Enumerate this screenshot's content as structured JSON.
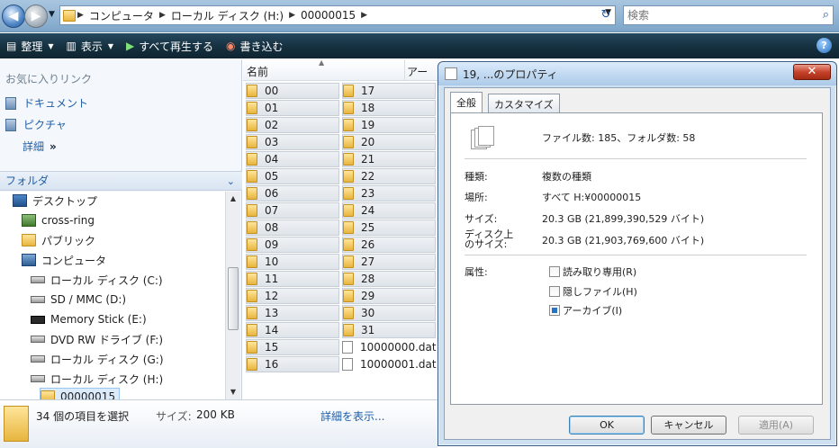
{
  "address": {
    "crumbs": [
      "コンピュータ",
      "ローカル ディスク (H:)",
      "00000015"
    ],
    "search_placeholder": "検索"
  },
  "toolbar": {
    "organize": "整理",
    "views": "表示",
    "play_all": "すべて再生する",
    "burn": "書き込む"
  },
  "favorites": {
    "title": "お気に入りリンク",
    "items": [
      "ドキュメント",
      "ピクチャ"
    ],
    "more": "詳細"
  },
  "folders": {
    "title": "フォルダ",
    "tree": [
      {
        "label": "デスクトップ",
        "icon": "desktop-icon"
      },
      {
        "label": "cross-ring",
        "icon": "network-icon"
      },
      {
        "label": "パブリック",
        "icon": "folder-icon"
      },
      {
        "label": "コンピュータ",
        "icon": "computer-icon"
      },
      {
        "label": "ローカル ディスク (C:)",
        "icon": "drive-icon"
      },
      {
        "label": "SD / MMC (D:)",
        "icon": "drive-icon"
      },
      {
        "label": "Memory Stick (E:)",
        "icon": "memory-stick-icon"
      },
      {
        "label": "DVD RW ドライブ (F:)",
        "icon": "dvd-drive-icon"
      },
      {
        "label": "ローカル ディスク (G:)",
        "icon": "drive-icon"
      },
      {
        "label": "ローカル ディスク (H:)",
        "icon": "drive-icon"
      },
      {
        "label": "00000015",
        "icon": "folder-icon"
      }
    ]
  },
  "filelist": {
    "col_name": "名前",
    "col_archive": "アー",
    "col1": [
      "00",
      "01",
      "02",
      "03",
      "04",
      "05",
      "06",
      "07",
      "08",
      "09",
      "10",
      "11",
      "12",
      "13",
      "14",
      "15",
      "16"
    ],
    "col2": [
      "17",
      "18",
      "19",
      "20",
      "21",
      "22",
      "23",
      "24",
      "25",
      "26",
      "27",
      "28",
      "29",
      "30",
      "31",
      "10000000.dat",
      "10000001.dat"
    ]
  },
  "details": {
    "count": "34 個の項目を選択",
    "size_label": "サイズ:",
    "size_value": "200 KB",
    "show_details": "詳細を表示..."
  },
  "dialog": {
    "title": "19, ...のプロパティ",
    "tabs": [
      "全般",
      "カスタマイズ"
    ],
    "summary": "ファイル数: 185、フォルダ数: 58",
    "type_label": "種類:",
    "type_value": "複数の種類",
    "location_label": "場所:",
    "location_value": "すべて H:¥00000015",
    "size_label": "サイズ:",
    "size_value": "20.3 GB (21,899,390,529 バイト)",
    "disk_size_label_1": "ディスク上",
    "disk_size_label_2": "のサイズ:",
    "disk_size_value": "20.3 GB (21,903,769,600 バイト)",
    "attr_label": "属性:",
    "readonly": "読み取り専用(R)",
    "hidden": "隠しファイル(H)",
    "archive": "アーカイブ(I)",
    "ok": "OK",
    "cancel": "キャンセル",
    "apply": "適用(A)"
  }
}
